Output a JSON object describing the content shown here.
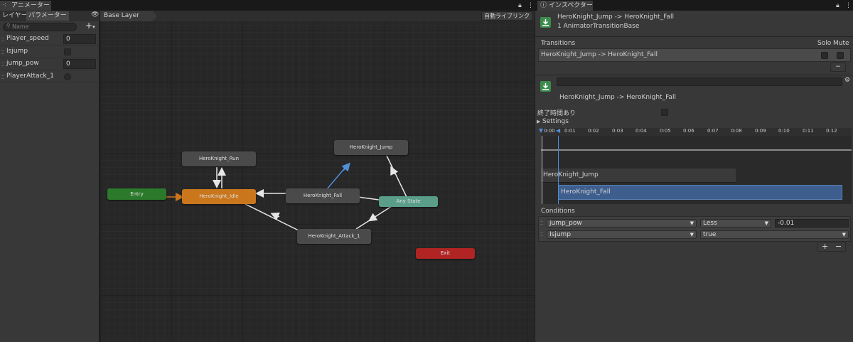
{
  "animator": {
    "tab_title": "アニメーター",
    "subtabs": [
      "レイヤー",
      "パラメーター"
    ],
    "search_placeholder": "Name",
    "breadcrumb": "Base Layer",
    "auto_live_link": "自動ライブリンク",
    "parameters": [
      {
        "name": "Player_speed",
        "type": "float",
        "value": "0"
      },
      {
        "name": "Isjump",
        "type": "bool",
        "value": ""
      },
      {
        "name": "jump_pow",
        "type": "float",
        "value": "0"
      },
      {
        "name": "PlayerAttack_1",
        "type": "trigger",
        "value": ""
      }
    ],
    "states": {
      "run": "HeroKnight_Run",
      "jump": "HeroKnight_Jump",
      "entry": "Entry",
      "idle": "HeroKnight_Idle",
      "fall": "HeroKnight_Fall",
      "any": "Any State",
      "attack": "HeroKnight_Attack_1",
      "exit": "Exit"
    },
    "colors": {
      "entry": "#2b7a2b",
      "default": "#c9761c",
      "any": "#5a9e8a",
      "exit": "#b02424",
      "state": "#4a4a4a",
      "selected_transition": "#3f79c8"
    }
  },
  "inspector": {
    "tab_title": "インスペクター",
    "header_title": "HeroKnight_Jump -> HeroKnight_Fall",
    "header_subtitle": "1 AnimatorTransitionBase",
    "transitions_label": "Transitions",
    "solo_label": "Solo",
    "mute_label": "Mute",
    "transition_row": "HeroKnight_Jump -> HeroKnight_Fall",
    "minus": "−",
    "plus": "+",
    "name_field": "",
    "transition_name": "HeroKnight_Jump -> HeroKnight_Fall",
    "has_exit_time": "終了時間あり",
    "settings": "Settings",
    "timeline_ticks": [
      "0:00",
      "0:01",
      "0:02",
      "0:03",
      "0:04",
      "0:05",
      "0:06",
      "0:07",
      "0:08",
      "0:09",
      "0:10",
      "0:11",
      "0:12"
    ],
    "timeline_from": "HeroKnight_Jump",
    "timeline_to": "HeroKnight_Fall",
    "conditions_label": "Conditions",
    "conditions": [
      {
        "param": "jump_pow",
        "mode": "Less",
        "value": "-0.01"
      },
      {
        "param": "Isjump",
        "mode": "true",
        "value": ""
      }
    ]
  }
}
